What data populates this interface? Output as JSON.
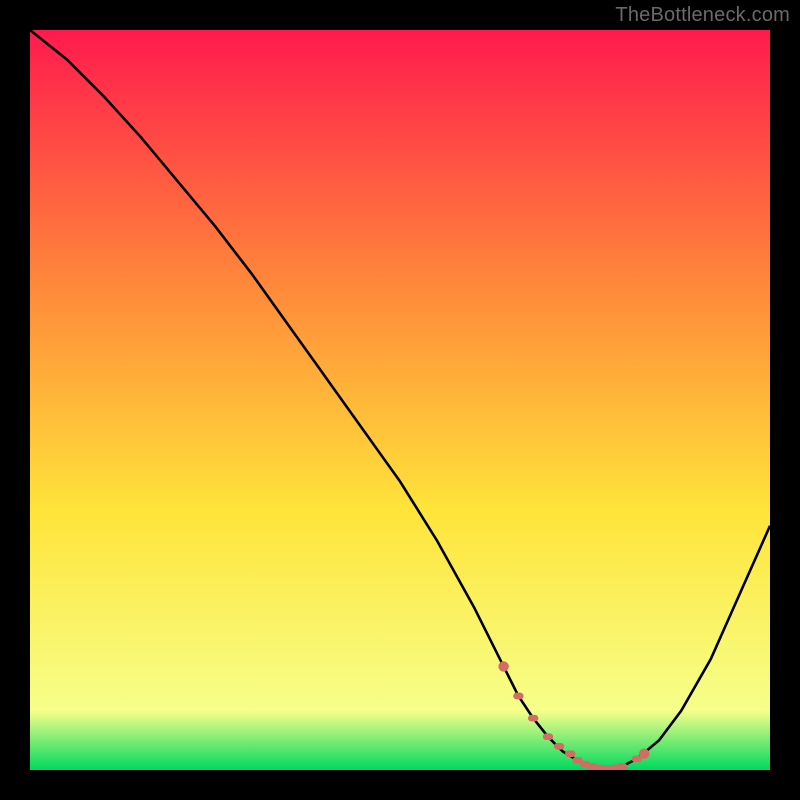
{
  "watermark": "TheBottleneck.com",
  "chart_data": {
    "type": "line",
    "title": "",
    "xlabel": "",
    "ylabel": "",
    "xlim": [
      0,
      100
    ],
    "ylim": [
      0,
      100
    ],
    "grid": false,
    "legend": false,
    "series": [
      {
        "name": "curve",
        "x": [
          0,
          5,
          10,
          15,
          20,
          25,
          30,
          35,
          40,
          45,
          50,
          55,
          60,
          62,
          64,
          66,
          68,
          70,
          72,
          74,
          76,
          78,
          80,
          82,
          85,
          88,
          92,
          96,
          100
        ],
        "y": [
          100,
          96,
          91,
          85.5,
          79.5,
          73.5,
          67,
          60,
          53,
          46,
          39,
          31,
          22,
          18,
          14,
          10,
          7,
          4.5,
          2.5,
          1.3,
          0.5,
          0.2,
          0.5,
          1.5,
          4,
          8,
          15,
          24,
          33
        ]
      }
    ],
    "highlight_points": {
      "name": "highlight",
      "x": [
        64,
        66,
        68,
        70,
        71.5,
        73,
        74,
        75,
        76,
        77,
        78,
        79,
        80,
        82,
        83
      ],
      "y": [
        14,
        10,
        7,
        4.5,
        3.2,
        2.2,
        1.3,
        0.8,
        0.5,
        0.3,
        0.2,
        0.3,
        0.5,
        1.5,
        2.2
      ]
    },
    "background_gradient": {
      "top": "#ff1a4d",
      "mid1": "#ff8a3a",
      "mid2": "#ffe43a",
      "near_bottom": "#f6ff8a",
      "bottom": "#00d95f"
    }
  }
}
